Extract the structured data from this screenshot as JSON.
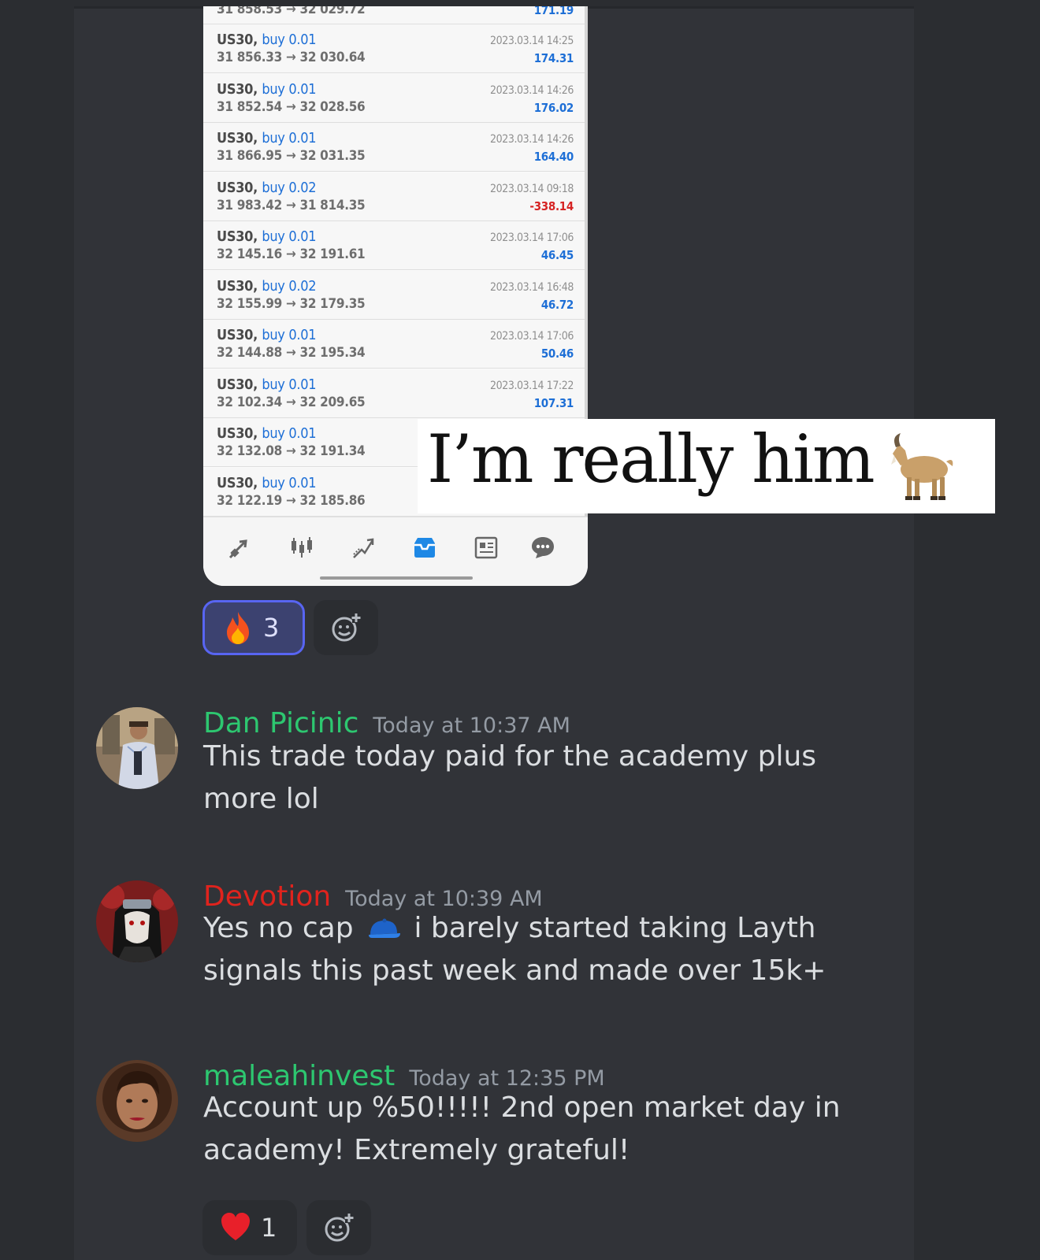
{
  "colors": {
    "page_bg": "#2b2d31",
    "chat_bg": "#313338",
    "buy_blue": "#1e6fd6",
    "loss_red": "#d62424",
    "name_green": "#2dc770",
    "name_red": "#e0231d",
    "timestamp": "#949ba4",
    "message_text": "#dbdee1",
    "reaction_active": "#5865f2"
  },
  "phone": {
    "partial_row": {
      "line2": "31 858.53 → 32 029.72",
      "profit": "171.19"
    },
    "trades": [
      {
        "symbol": "US30,",
        "direction": "buy 0.01",
        "prices": "31 856.33 → 32 030.64",
        "date": "2023.03.14 14:25",
        "profit": "174.31"
      },
      {
        "symbol": "US30,",
        "direction": "buy 0.01",
        "prices": "31 852.54 → 32 028.56",
        "date": "2023.03.14 14:26",
        "profit": "176.02"
      },
      {
        "symbol": "US30,",
        "direction": "buy 0.01",
        "prices": "31 866.95 → 32 031.35",
        "date": "2023.03.14 14:26",
        "profit": "164.40"
      },
      {
        "symbol": "US30,",
        "direction": "buy 0.02",
        "prices": "31 983.42 → 31 814.35",
        "date": "2023.03.14 09:18",
        "profit": "-338.14"
      },
      {
        "symbol": "US30,",
        "direction": "buy 0.01",
        "prices": "32 145.16 → 32 191.61",
        "date": "2023.03.14 17:06",
        "profit": "46.45"
      },
      {
        "symbol": "US30,",
        "direction": "buy 0.02",
        "prices": "32 155.99 → 32 179.35",
        "date": "2023.03.14 16:48",
        "profit": "46.72"
      },
      {
        "symbol": "US30,",
        "direction": "buy 0.01",
        "prices": "32 144.88 → 32 195.34",
        "date": "2023.03.14 17:06",
        "profit": "50.46"
      },
      {
        "symbol": "US30,",
        "direction": "buy 0.01",
        "prices": "32 102.34 → 32 209.65",
        "date": "2023.03.14 17:22",
        "profit": "107.31"
      },
      {
        "symbol": "US30,",
        "direction": "buy 0.01",
        "prices": "32 132.08 → 32 191.34",
        "date": "",
        "profit": ""
      },
      {
        "symbol": "US30,",
        "direction": "buy 0.01",
        "prices": "32 122.19 → 32 185.86",
        "date": "",
        "profit": ""
      }
    ],
    "tabs": [
      "trade-arrows-icon",
      "candlestick-chart-icon",
      "trending-icon",
      "inbox-icon",
      "news-icon",
      "chat-bubble-icon"
    ],
    "active_tab": "inbox-icon"
  },
  "overlay": {
    "caption": "I’m really him",
    "emoji": "goat-emoji"
  },
  "reactions_top": {
    "emoji": "fire-emoji",
    "count": "3",
    "add_icon": "add-reaction-icon"
  },
  "messages": [
    {
      "author": "Dan Picinic",
      "author_color": "#2dc770",
      "timestamp": "Today at 10:37 AM",
      "text": "This trade today paid for the academy plus more lol"
    },
    {
      "author": "Devotion",
      "author_color": "#e0231d",
      "timestamp": "Today at 10:39 AM",
      "text_before": "Yes no cap",
      "inline_emoji": "blue-cap-emoji",
      "text_after": "i barely started taking Layth signals this past week and made over 15k+"
    },
    {
      "author": "maleahinvest",
      "author_color": "#2dc770",
      "timestamp": "Today at 12:35 PM",
      "text": "Account up %50!!!!! 2nd open market day in academy! Extremely grateful!"
    }
  ],
  "reactions_bottom": {
    "emoji": "heart-emoji",
    "count": "1",
    "add_icon": "add-reaction-icon"
  }
}
